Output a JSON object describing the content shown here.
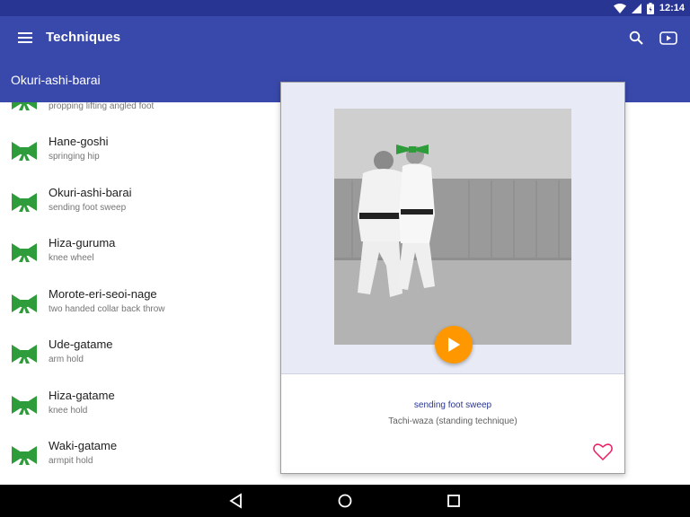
{
  "status_bar": {
    "time": "12:14"
  },
  "app_bar": {
    "title": "Techniques",
    "current_technique": "Okuri-ashi-barai"
  },
  "icons": {
    "menu": "hamburger-menu-icon",
    "search": "search-icon",
    "youtube": "youtube-icon",
    "belt": "green-belt-icon",
    "favorite": "heart-outline-icon",
    "play": "play-icon"
  },
  "colors": {
    "status_bar": "#283593",
    "app_bar": "#3949ab",
    "belt": "#2e9c3a",
    "play_button": "#ff9800",
    "heart": "#e91e63",
    "card_media_bg": "#e8eaf6"
  },
  "techniques": [
    {
      "name": "",
      "translation": "propping lifting angled foot",
      "partial": true
    },
    {
      "name": "Hane-goshi",
      "translation": "springing hip"
    },
    {
      "name": "Okuri-ashi-barai",
      "translation": "sending foot sweep"
    },
    {
      "name": "Hiza-guruma",
      "translation": "knee wheel"
    },
    {
      "name": "Morote-eri-seoi-nage",
      "translation": "two handed collar back throw"
    },
    {
      "name": "Ude-gatame",
      "translation": "arm hold"
    },
    {
      "name": "Hiza-gatame",
      "translation": "knee hold"
    },
    {
      "name": "Waki-gatame",
      "translation": "armpit hold"
    }
  ],
  "detail_card": {
    "translation": "sending foot sweep",
    "category": "Tachi-waza (standing technique)"
  }
}
